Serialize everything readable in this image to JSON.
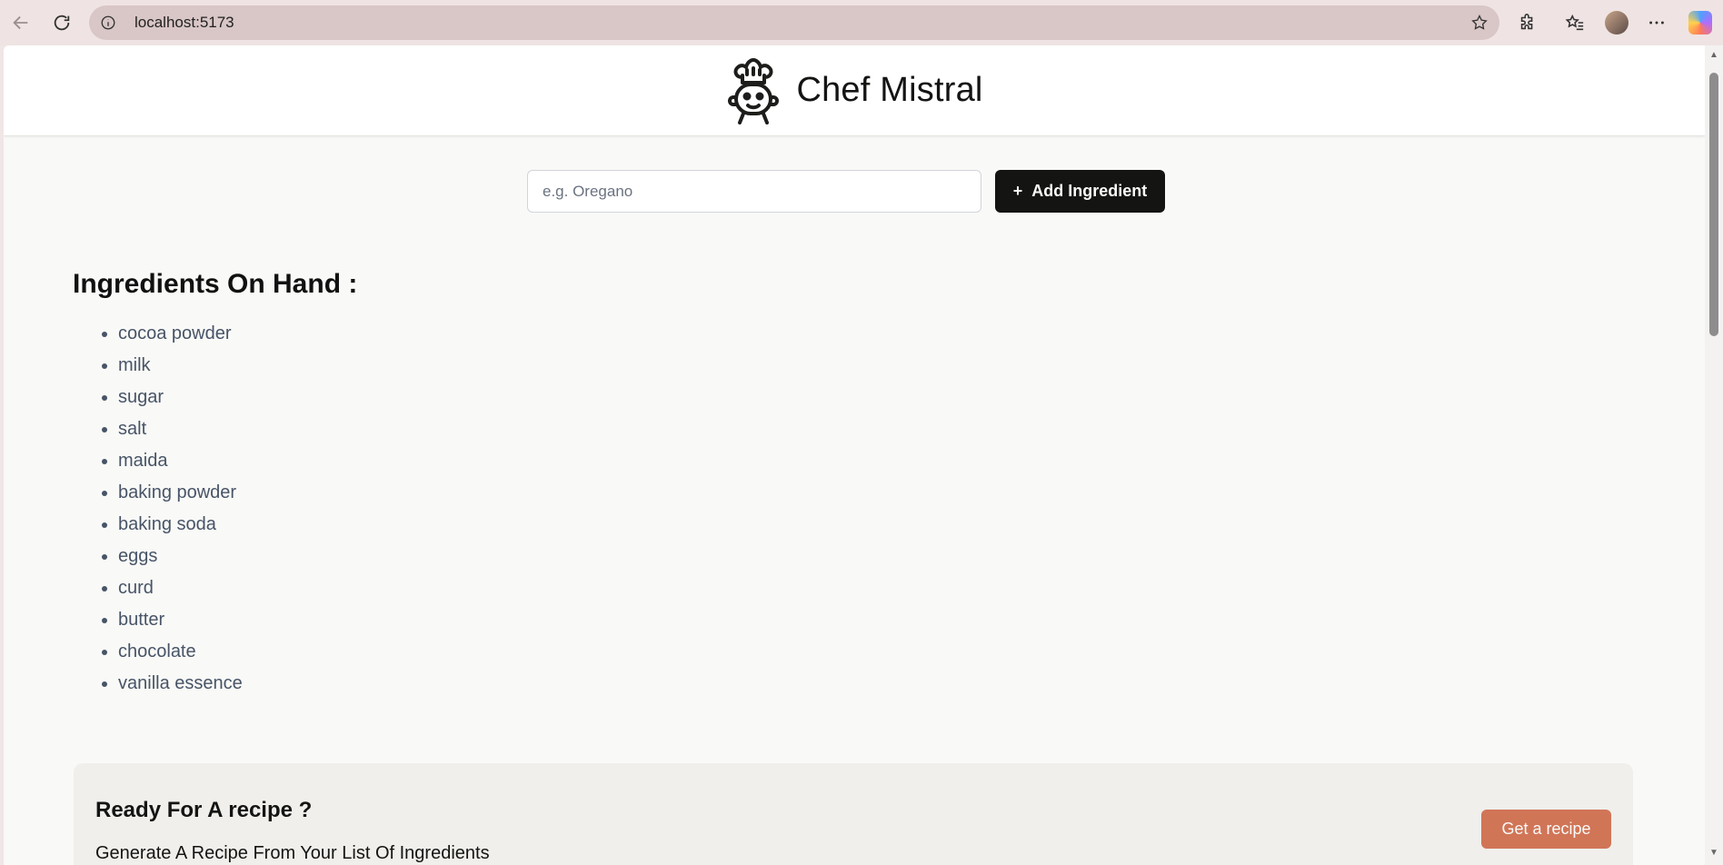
{
  "browser": {
    "url": "localhost:5173"
  },
  "header": {
    "title": "Chef Mistral"
  },
  "form": {
    "placeholder": "e.g. Oregano",
    "add_button_icon": "+",
    "add_button_label": "Add Ingredient"
  },
  "ingredients": {
    "title": "Ingredients On Hand :",
    "items": [
      "cocoa powder",
      "milk",
      "sugar",
      "salt",
      "maida",
      "baking powder",
      "baking soda",
      "eggs",
      "curd",
      "butter",
      "chocolate",
      "vanilla essence"
    ]
  },
  "recipe_card": {
    "title": "Ready For A recipe ?",
    "subtitle": "Generate A Recipe From Your List Of Ingredients",
    "button_label": "Get a recipe"
  },
  "colors": {
    "accent": "#d17557",
    "primary_button": "#141413",
    "page_background": "#f9f9f7",
    "card_background": "#f0efeb"
  }
}
